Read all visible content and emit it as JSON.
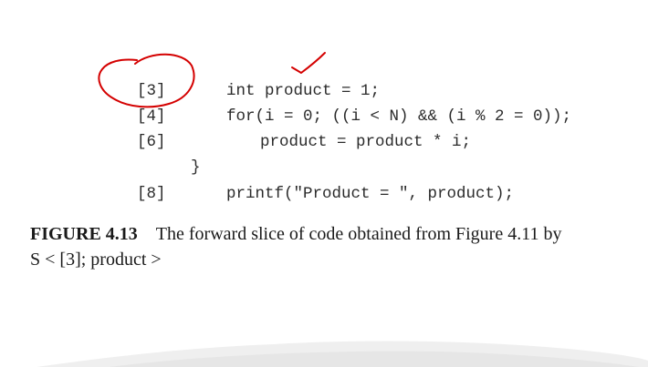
{
  "code": {
    "lines": [
      {
        "num": "[3]",
        "text": "int product = 1;"
      },
      {
        "num": "[4]",
        "text": "for(i = 0; ((i < N) && (i % 2 = 0));"
      },
      {
        "num": "[6]",
        "text": "product = product * i;"
      },
      {
        "num": "",
        "text": "}"
      },
      {
        "num": "[8]",
        "text": "printf(\"Product = \", product);"
      }
    ]
  },
  "caption": {
    "label": "FIGURE 4.13",
    "text": "The forward slice of code obtained from Figure 4.11 by",
    "line2": "S < [3]; product >"
  },
  "annotations": {
    "ink_color": "#d40000"
  }
}
